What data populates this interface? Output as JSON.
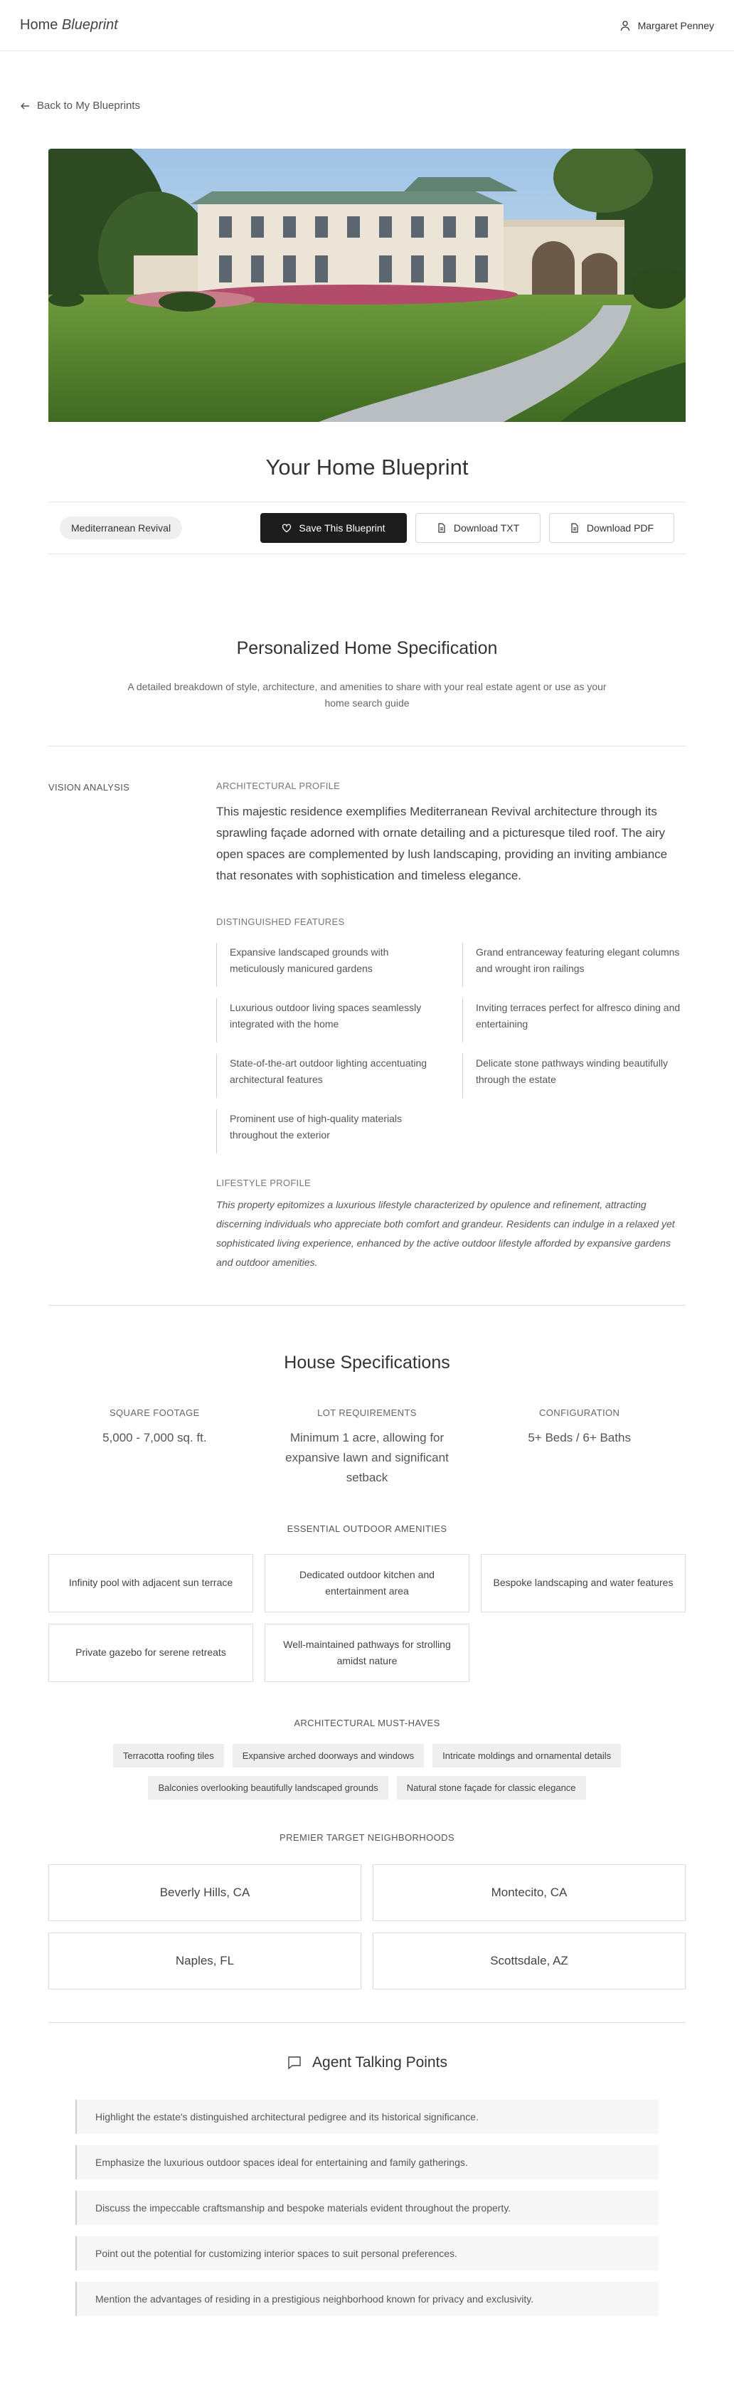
{
  "header": {
    "brand_plain": "Home",
    "brand_italic": "Blueprint",
    "user_name": "Margaret Penney"
  },
  "nav": {
    "back_label": "Back to My Blueprints"
  },
  "hero": {
    "image": "mansion-photo"
  },
  "page_title": "Your Home Blueprint",
  "actionbar": {
    "style_tag": "Mediterranean Revival",
    "save_label": "Save This Blueprint",
    "download_txt_label": "Download TXT",
    "download_pdf_label": "Download PDF"
  },
  "spec": {
    "title": "Personalized Home Specification",
    "subtitle": "A detailed breakdown of style, architecture, and amenities to share with your real estate agent or use as your home search guide"
  },
  "vision": {
    "label": "VISION ANALYSIS",
    "profile_title": "ARCHITECTURAL PROFILE",
    "profile_text": "This majestic residence exemplifies Mediterranean Revival architecture through its sprawling façade adorned with ornate detailing and a picturesque tiled roof. The airy open spaces are complemented by lush landscaping, providing an inviting ambiance that resonates with sophistication and timeless elegance.",
    "features_title": "DISTINGUISHED FEATURES",
    "features": [
      "Expansive landscaped grounds with meticulously manicured gardens",
      "Grand entranceway featuring elegant columns and wrought iron railings",
      "Luxurious outdoor living spaces seamlessly integrated with the home",
      "Inviting terraces perfect for alfresco dining and entertaining",
      "State-of-the-art outdoor lighting accentuating architectural features",
      "Delicate stone pathways winding beautifully through the estate",
      "Prominent use of high-quality materials throughout the exterior"
    ],
    "lifestyle_title": "LIFESTYLE PROFILE",
    "lifestyle_text": "This property epitomizes a luxurious lifestyle characterized by opulence and refinement, attracting discerning individuals who appreciate both comfort and grandeur. Residents can indulge in a relaxed yet sophisticated living experience, enhanced by the active outdoor lifestyle afforded by expansive gardens and outdoor amenities."
  },
  "house": {
    "title": "House Specifications",
    "specs": [
      {
        "label": "SQUARE FOOTAGE",
        "value": "5,000 - 7,000 sq. ft."
      },
      {
        "label": "LOT REQUIREMENTS",
        "value": "Minimum 1 acre, allowing for expansive lawn and significant setback"
      },
      {
        "label": "CONFIGURATION",
        "value": "5+ Beds / 6+ Baths"
      }
    ],
    "amenities_title": "ESSENTIAL OUTDOOR AMENITIES",
    "amenities": [
      "Infinity pool with adjacent sun terrace",
      "Dedicated outdoor kitchen and entertainment area",
      "Bespoke landscaping and water features",
      "Private gazebo for serene retreats",
      "Well-maintained pathways for strolling amidst nature"
    ],
    "musthaves_title": "ARCHITECTURAL MUST-HAVES",
    "musthaves": [
      "Terracotta roofing tiles",
      "Expansive arched doorways and windows",
      "Intricate moldings and ornamental details",
      "Balconies overlooking beautifully landscaped grounds",
      "Natural stone façade for classic elegance"
    ],
    "neighborhoods_title": "PREMIER TARGET NEIGHBORHOODS",
    "neighborhoods": [
      "Beverly Hills, CA",
      "Montecito, CA",
      "Naples, FL",
      "Scottsdale, AZ"
    ]
  },
  "agent": {
    "title": "Agent Talking Points",
    "points": [
      "Highlight the estate's distinguished architectural pedigree and its historical significance.",
      "Emphasize the luxurious outdoor spaces ideal for entertaining and family gatherings.",
      "Discuss the impeccable craftsmanship and bespoke materials evident throughout the property.",
      "Point out the potential for customizing interior spaces to suit personal preferences.",
      "Mention the advantages of residing in a prestigious neighborhood known for privacy and exclusivity."
    ]
  }
}
